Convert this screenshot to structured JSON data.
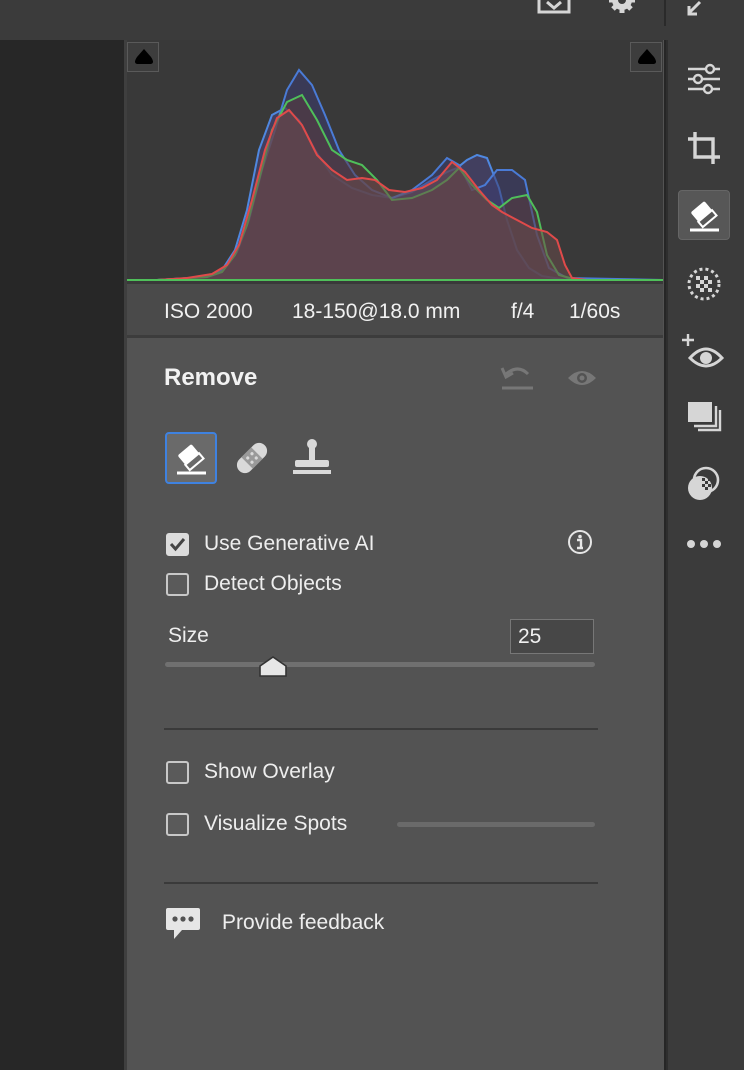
{
  "histogram": {
    "exif": {
      "iso": "ISO 2000",
      "lens": "18-150@18.0 mm",
      "aperture": "f/4",
      "shutter": "1/60s"
    }
  },
  "panel": {
    "title": "Remove",
    "tools": [
      "eraser-icon",
      "bandage-icon",
      "stamp-icon"
    ],
    "options": {
      "use_generative_ai": {
        "label": "Use Generative AI",
        "checked": true
      },
      "detect_objects": {
        "label": "Detect Objects",
        "checked": false
      }
    },
    "size": {
      "label": "Size",
      "value": "25",
      "slider_fraction": 0.25
    },
    "show_overlay": {
      "label": "Show Overlay",
      "checked": false
    },
    "visualize_spots": {
      "label": "Visualize Spots",
      "checked": false
    },
    "feedback": {
      "label": "Provide feedback"
    }
  },
  "rail": [
    "sliders-icon",
    "crop-icon",
    "eraser-icon",
    "masking-icon",
    "redeye-icon",
    "presets-icon",
    "layers-blend-icon",
    "more-icon"
  ],
  "colors": {
    "accent": "#3f82e0",
    "panel": "#535353",
    "rail": "#3b3b3b"
  }
}
